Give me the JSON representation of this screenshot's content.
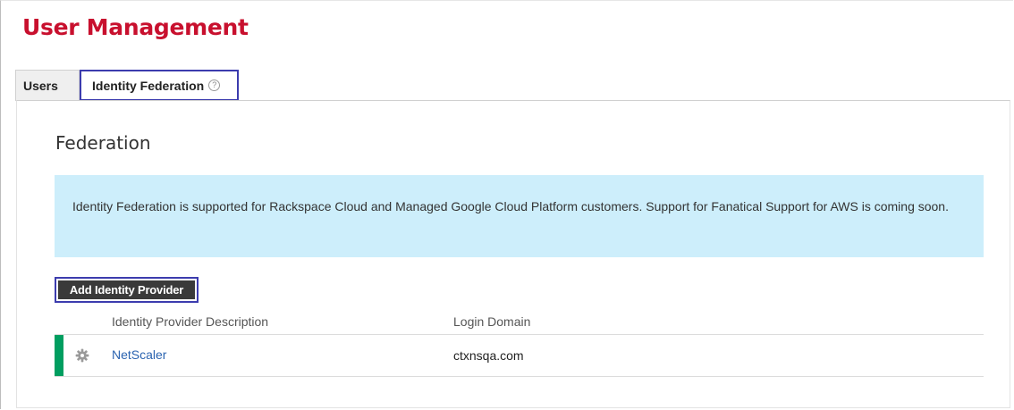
{
  "page": {
    "title": "User Management"
  },
  "tabs": [
    {
      "label": "Users",
      "active": false
    },
    {
      "label": "Identity Federation",
      "active": true,
      "help_icon": "question-circle-icon"
    }
  ],
  "section": {
    "title": "Federation"
  },
  "info": {
    "text": "Identity Federation is supported for Rackspace Cloud and Managed Google Cloud Platform customers. Support for Fanatical Support for AWS is coming soon."
  },
  "actions": {
    "add_provider_label": "Add Identity Provider"
  },
  "table": {
    "columns": [
      "Identity Provider Description",
      "Login Domain"
    ],
    "rows": [
      {
        "name": "NetScaler",
        "domain": "ctxnsqa.com",
        "status_color": "#009e60",
        "action_icon": "gear-icon"
      }
    ]
  },
  "colors": {
    "brand_title": "#c8102e",
    "info_background": "#cdeefb",
    "link": "#2a63b0",
    "highlight_outline": "#3c3cae"
  }
}
